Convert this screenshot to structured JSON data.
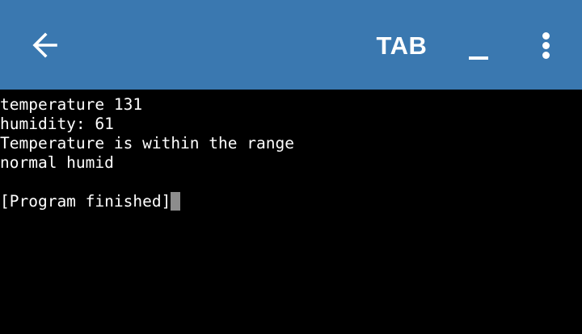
{
  "toolbar": {
    "back_icon": "arrow-left-icon",
    "tab_label": "TAB",
    "underscore_icon": "underscore-icon",
    "more_icon": "more-vertical-icon",
    "background_color": "#3a78b0"
  },
  "terminal": {
    "lines": [
      "temperature 131",
      "humidity: 61",
      "Temperature is within the range",
      "normal humid",
      "",
      "[Program finished]"
    ],
    "cursor_color": "#8c8c8c"
  }
}
